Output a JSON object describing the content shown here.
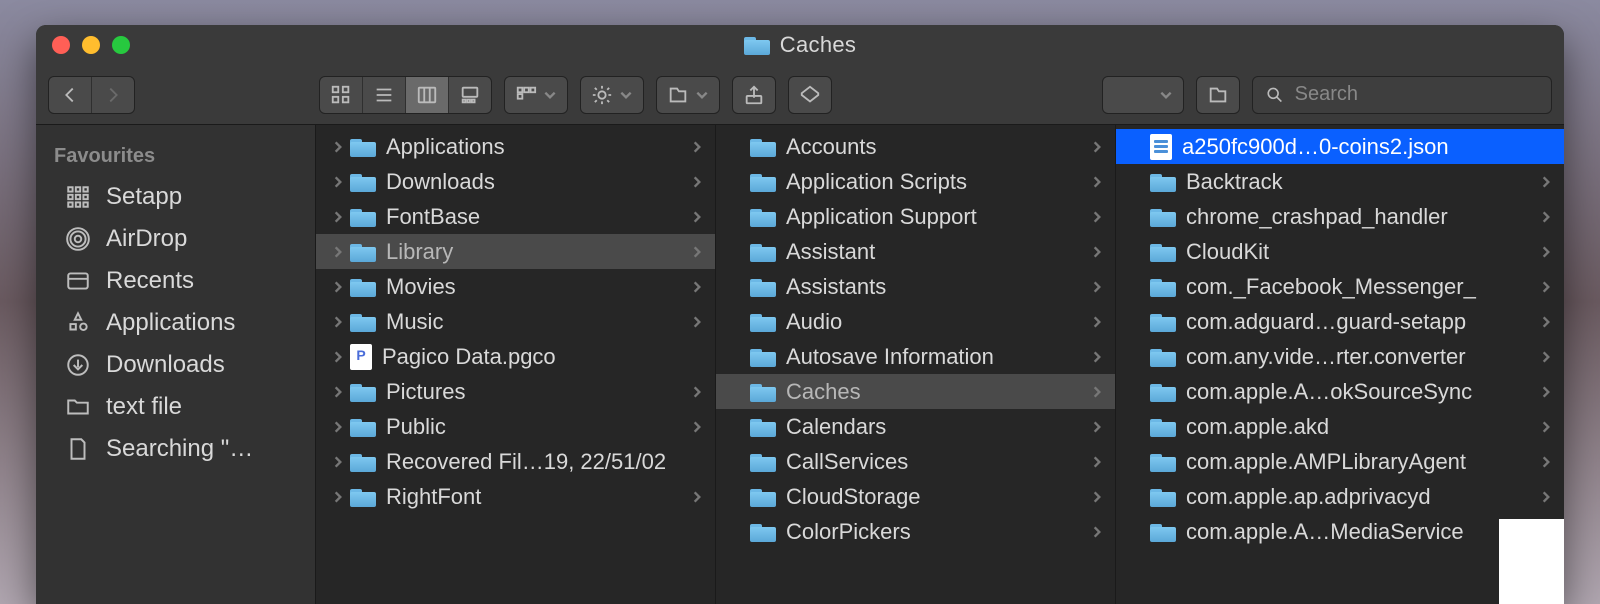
{
  "window": {
    "title": "Caches"
  },
  "search": {
    "placeholder": "Search"
  },
  "sidebar": {
    "header": "Favourites",
    "items": [
      {
        "label": "Setapp",
        "icon": "grid"
      },
      {
        "label": "AirDrop",
        "icon": "airdrop"
      },
      {
        "label": "Recents",
        "icon": "recents"
      },
      {
        "label": "Applications",
        "icon": "apps"
      },
      {
        "label": "Downloads",
        "icon": "downloads"
      },
      {
        "label": "text file",
        "icon": "folder-grey"
      },
      {
        "label": "Searching \"…",
        "icon": "doc"
      }
    ]
  },
  "columns": {
    "col1": [
      {
        "label": "Applications",
        "folder": true,
        "chev": true
      },
      {
        "label": "Downloads",
        "folder": true,
        "chev": true
      },
      {
        "label": "FontBase",
        "folder": true,
        "chev": true
      },
      {
        "label": "Library",
        "folder": true,
        "chev": true,
        "pathSelected": true
      },
      {
        "label": "Movies",
        "folder": true,
        "chev": true
      },
      {
        "label": "Music",
        "folder": true,
        "chev": true
      },
      {
        "label": "Pagico Data.pgco",
        "fileP": true
      },
      {
        "label": "Pictures",
        "folder": true,
        "chev": true
      },
      {
        "label": "Public",
        "folder": true,
        "chev": true
      },
      {
        "label": "Recovered Fil…19, 22/51/02",
        "folder": true
      },
      {
        "label": "RightFont",
        "folder": true,
        "chev": true
      }
    ],
    "col2": [
      {
        "label": "Accounts",
        "folder": true,
        "chev": true
      },
      {
        "label": "Application Scripts",
        "folder": true,
        "chev": true
      },
      {
        "label": "Application Support",
        "folder": true,
        "chev": true
      },
      {
        "label": "Assistant",
        "folder": true,
        "chev": true
      },
      {
        "label": "Assistants",
        "folder": true,
        "chev": true
      },
      {
        "label": "Audio",
        "folder": true,
        "chev": true
      },
      {
        "label": "Autosave Information",
        "folder": true,
        "chev": true
      },
      {
        "label": "Caches",
        "folder": true,
        "chev": true,
        "pathSelected": true
      },
      {
        "label": "Calendars",
        "folder": true,
        "chev": true
      },
      {
        "label": "CallServices",
        "folder": true,
        "chev": true
      },
      {
        "label": "CloudStorage",
        "folder": true,
        "chev": true
      },
      {
        "label": "ColorPickers",
        "folder": true,
        "chev": true
      }
    ],
    "col3": [
      {
        "label": "a250fc900d…0-coins2.json",
        "file": true,
        "selected": true
      },
      {
        "label": "Backtrack",
        "folder": true,
        "chev": true
      },
      {
        "label": "chrome_crashpad_handler",
        "folder": true,
        "chev": true
      },
      {
        "label": "CloudKit",
        "folder": true,
        "chev": true
      },
      {
        "label": "com._Facebook_Messenger_",
        "folder": true,
        "chev": true
      },
      {
        "label": "com.adguard…guard-setapp",
        "folder": true,
        "chev": true
      },
      {
        "label": "com.any.vide…rter.converter",
        "folder": true,
        "chev": true
      },
      {
        "label": "com.apple.A…okSourceSync",
        "folder": true,
        "chev": true
      },
      {
        "label": "com.apple.akd",
        "folder": true,
        "chev": true
      },
      {
        "label": "com.apple.AMPLibraryAgent",
        "folder": true,
        "chev": true
      },
      {
        "label": "com.apple.ap.adprivacyd",
        "folder": true,
        "chev": true
      },
      {
        "label": "com.apple.A…MediaService",
        "folder": true,
        "chev": true
      }
    ]
  }
}
